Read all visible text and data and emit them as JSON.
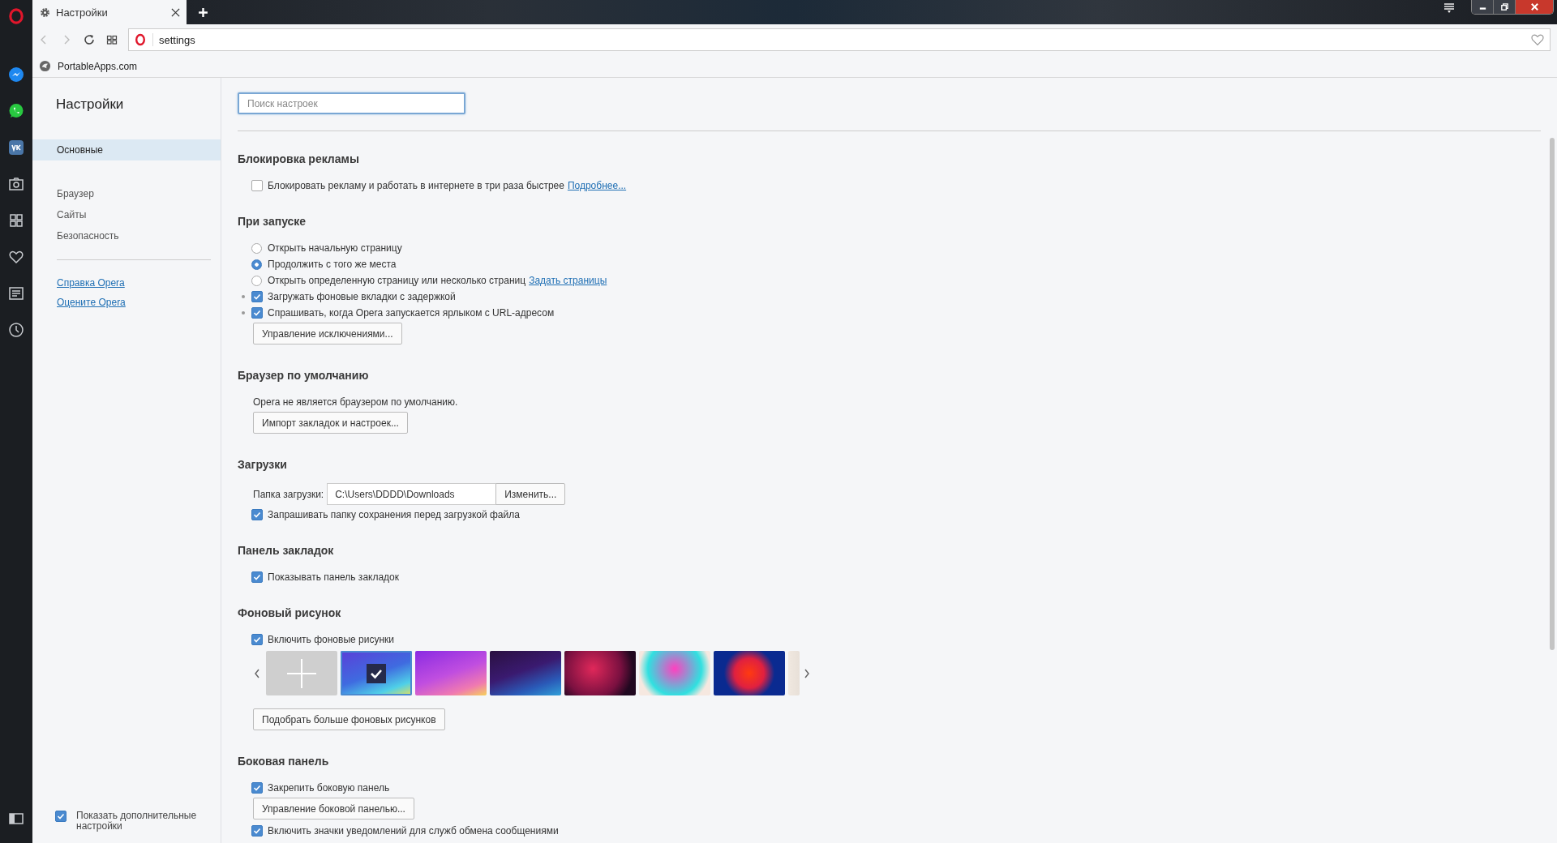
{
  "tab": {
    "title": "Настройки",
    "selected": true
  },
  "address_bar": {
    "url": "settings"
  },
  "bookmarks": [
    {
      "label": "PortableApps.com"
    }
  ],
  "sidebar": {
    "title": "Настройки",
    "items": [
      {
        "label": "Основные",
        "selected": true
      },
      {
        "label": "Браузер",
        "selected": false
      },
      {
        "label": "Сайты",
        "selected": false
      },
      {
        "label": "Безопасность",
        "selected": false
      }
    ],
    "links": [
      {
        "label": "Справка Opera"
      },
      {
        "label": "Оцените Opera"
      }
    ],
    "advanced": {
      "label": "Показать дополнительные настройки",
      "checked": true
    }
  },
  "search": {
    "placeholder": "Поиск настроек"
  },
  "sections": [
    {
      "title": "Блокировка рекламы",
      "items": [
        {
          "kind": "checkbox",
          "label": "Блокировать рекламу и работать в интернете в три раза быстрее",
          "checked": false,
          "flagged": false,
          "link": "Подробнее..."
        }
      ]
    },
    {
      "title": "При запуске",
      "items": [
        {
          "kind": "radio",
          "label": "Открыть начальную страницу",
          "selected": false
        },
        {
          "kind": "radio",
          "label": "Продолжить с того же места",
          "selected": true
        },
        {
          "kind": "radio",
          "label": "Открыть определенную страницу или несколько страниц",
          "selected": false,
          "link": "Задать страницы"
        },
        {
          "kind": "checkbox",
          "label": "Загружать фоновые вкладки с задержкой",
          "checked": true,
          "flagged": true
        },
        {
          "kind": "checkbox",
          "label": "Спрашивать, когда Opera запускается ярлыком с URL-адресом",
          "checked": true,
          "flagged": true
        },
        {
          "kind": "button",
          "label": "Управление исключениями..."
        }
      ]
    },
    {
      "title": "Браузер по умолчанию",
      "items": [
        {
          "kind": "text",
          "label": "Opera не является браузером по умолчанию."
        },
        {
          "kind": "button",
          "label": "Импорт закладок и настроек..."
        }
      ]
    },
    {
      "title": "Загрузки",
      "items": [
        {
          "kind": "folder",
          "label": "Папка загрузки:",
          "value": "C:\\Users\\DDDD\\Downloads",
          "button": "Изменить..."
        },
        {
          "kind": "checkbox",
          "label": "Запрашивать папку сохранения перед загрузкой файла",
          "checked": true,
          "flagged": false
        }
      ]
    },
    {
      "title": "Панель закладок",
      "items": [
        {
          "kind": "checkbox",
          "label": "Показывать панель закладок",
          "checked": true,
          "flagged": false
        }
      ]
    },
    {
      "title": "Фоновый рисунок",
      "items": [
        {
          "kind": "checkbox",
          "label": "Включить фоновые рисунки",
          "checked": true,
          "flagged": false
        },
        {
          "kind": "wallpapers",
          "thumbs": [
            {
              "kind": "add",
              "selected": false
            },
            {
              "kind": "image",
              "selected": true
            },
            {
              "kind": "image",
              "selected": false
            },
            {
              "kind": "image",
              "selected": false
            },
            {
              "kind": "image",
              "selected": false
            },
            {
              "kind": "image",
              "selected": false
            },
            {
              "kind": "image",
              "selected": false
            },
            {
              "kind": "image",
              "selected": false
            }
          ]
        },
        {
          "kind": "button",
          "label": "Подобрать больше фоновых рисунков"
        }
      ]
    },
    {
      "title": "Боковая панель",
      "items": [
        {
          "kind": "checkbox",
          "label": "Закрепить боковую панель",
          "checked": true,
          "flagged": false
        },
        {
          "kind": "button",
          "label": "Управление боковой панелью..."
        },
        {
          "kind": "checkbox",
          "label": "Включить значки уведомлений для служб обмена сообщениями",
          "checked": true,
          "flagged": false
        }
      ]
    }
  ]
}
